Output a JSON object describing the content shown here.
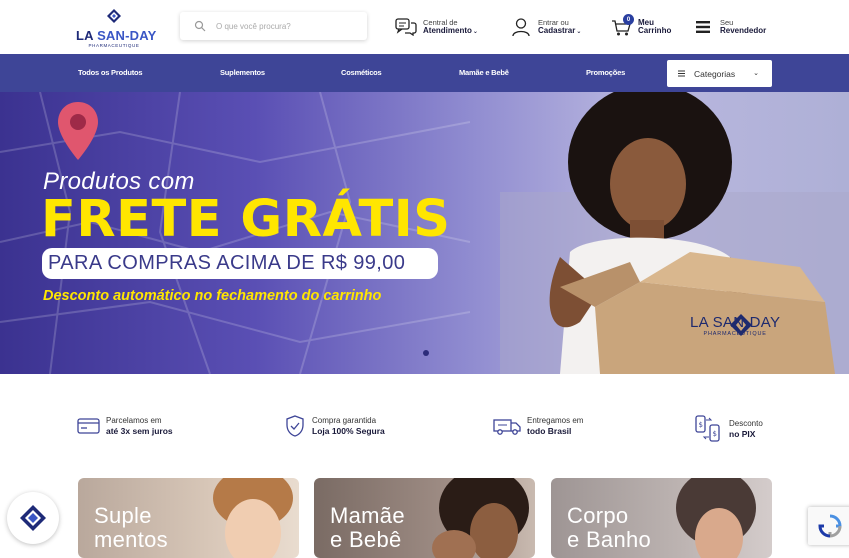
{
  "brand": {
    "name_part1": "LA",
    "name_part2": "SAN-DAY",
    "tagline": "PHARMACEUTIQUE"
  },
  "search": {
    "placeholder": "O que você procura?"
  },
  "header": {
    "support": {
      "line1": "Central de",
      "line2": "Atendimento"
    },
    "account": {
      "line1": "Entrar ou",
      "line2": "Cadastrar"
    },
    "cart": {
      "count": "0",
      "line1": "Meu",
      "line2": "Carrinho"
    },
    "reseller": {
      "line1": "Seu",
      "line2": "Revendedor"
    }
  },
  "nav": {
    "items": [
      "Todos os Produtos",
      "Suplementos",
      "Cosméticos",
      "Mamãe e Bebê",
      "Promoções"
    ],
    "categories_label": "Categorias"
  },
  "hero": {
    "line1": "Produtos com",
    "line2": "FRETE GRÁTIS",
    "line3": "PARA COMPRAS ACIMA DE R$ 99,00",
    "line4": "Desconto automático no fechamento do carrinho",
    "box_brand": "LA SAN-DAY",
    "box_sub": "PHARMACEUTIQUE"
  },
  "benefits": [
    {
      "icon": "credit-card-icon",
      "line1": "Parcelamos em",
      "line2": "até 3x sem juros"
    },
    {
      "icon": "shield-check-icon",
      "line1": "Compra garantida",
      "line2": "Loja 100% Segura"
    },
    {
      "icon": "truck-icon",
      "line1": "Entregamos em",
      "line2": "todo Brasil"
    },
    {
      "icon": "pix-transfer-icon",
      "line1": "Desconto",
      "line2": "no PIX"
    }
  ],
  "categories": [
    {
      "title": "Suple\nmentos",
      "color": "#c9b7a8"
    },
    {
      "title": "Mamãe\ne Bebê",
      "color": "#8a7a72"
    },
    {
      "title": "Corpo\ne Banho",
      "color": "#b2a8a6"
    }
  ],
  "colors": {
    "primary": "#3e4597",
    "accent_yellow": "#ffe600",
    "brand_dark": "#1e2a78"
  }
}
